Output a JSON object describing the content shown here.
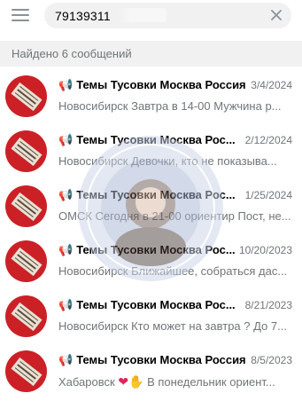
{
  "search": {
    "query": "79139311"
  },
  "results_label": "Найдено 6 сообщений",
  "colors": {
    "avatar": "#cc2027",
    "secondary_text": "#707579",
    "results_bar": "#f1f1f1"
  },
  "rows": [
    {
      "name": "Темы Тусовки Москва Россия",
      "date": "3/4/2024",
      "message": "Новосибирск  Завтра в 14-00 Мужчина р..."
    },
    {
      "name": "Темы Тусовки Москва Рос...",
      "date": "2/12/2024",
      "message": "Новосибирск  Девочки, кто не показыва..."
    },
    {
      "name": "Темы Тусовки Москва Рос...",
      "date": "1/25/2024",
      "message": "ОМСК Сегодня в 21-00 ориентир  Пост, не..."
    },
    {
      "name": "Темы Тусовки Москва Рос...",
      "date": "10/20/2023",
      "message": "Новосибирск  Ближайшее, собраться дас..."
    },
    {
      "name": "Темы Тусовки Москва Рос...",
      "date": "8/21/2023",
      "message": "Новосибирск  Кто может на завтра ? До 7..."
    },
    {
      "name": "Темы Тусовки Москва Россия",
      "date": "8/5/2023",
      "message_prefix": "Хабаровск",
      "message_suffix": "В понедельник ориент..."
    }
  ],
  "icons": {
    "menu": "hamburger-icon",
    "clear": "close-icon",
    "channel": "megaphone-icon"
  }
}
